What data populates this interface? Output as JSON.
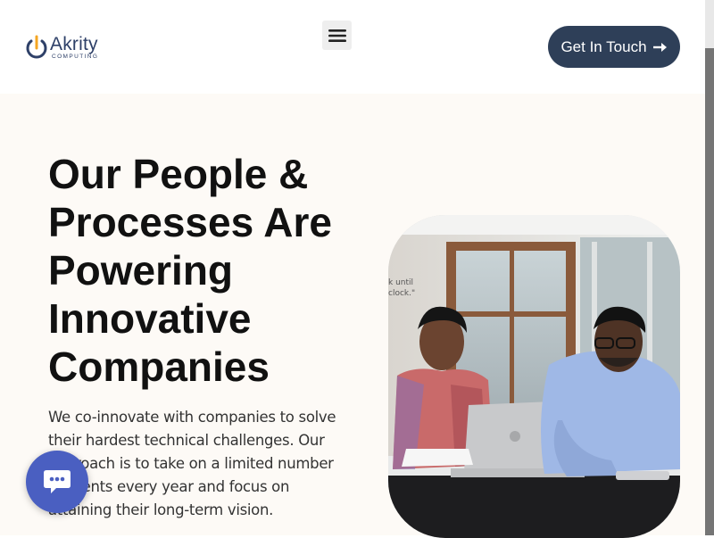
{
  "brand": {
    "name": "Akrity",
    "tagline": "COMPUTING",
    "logo_color": "#2e4068",
    "accent": "#f5a623"
  },
  "nav": {
    "menu_icon": "hamburger-icon",
    "cta_label": "Get In Touch",
    "cta_icon": "arrow-right-icon",
    "cta_color": "#2e3f58"
  },
  "hero": {
    "heading": "Our People & Processes Are Powering Innovative Companies",
    "description": "We co-innovate with companies to solve their hardest technical challenges. Our approach is to take on a limited number of clients every year and focus on attaining their long-term vision.",
    "background": "#fdfaf6"
  },
  "photo": {
    "wall_text_line1": "k until",
    "wall_text_line2": "clock.\""
  },
  "chat": {
    "icon": "chat-bubble-icon",
    "color": "#4a5fc1"
  }
}
